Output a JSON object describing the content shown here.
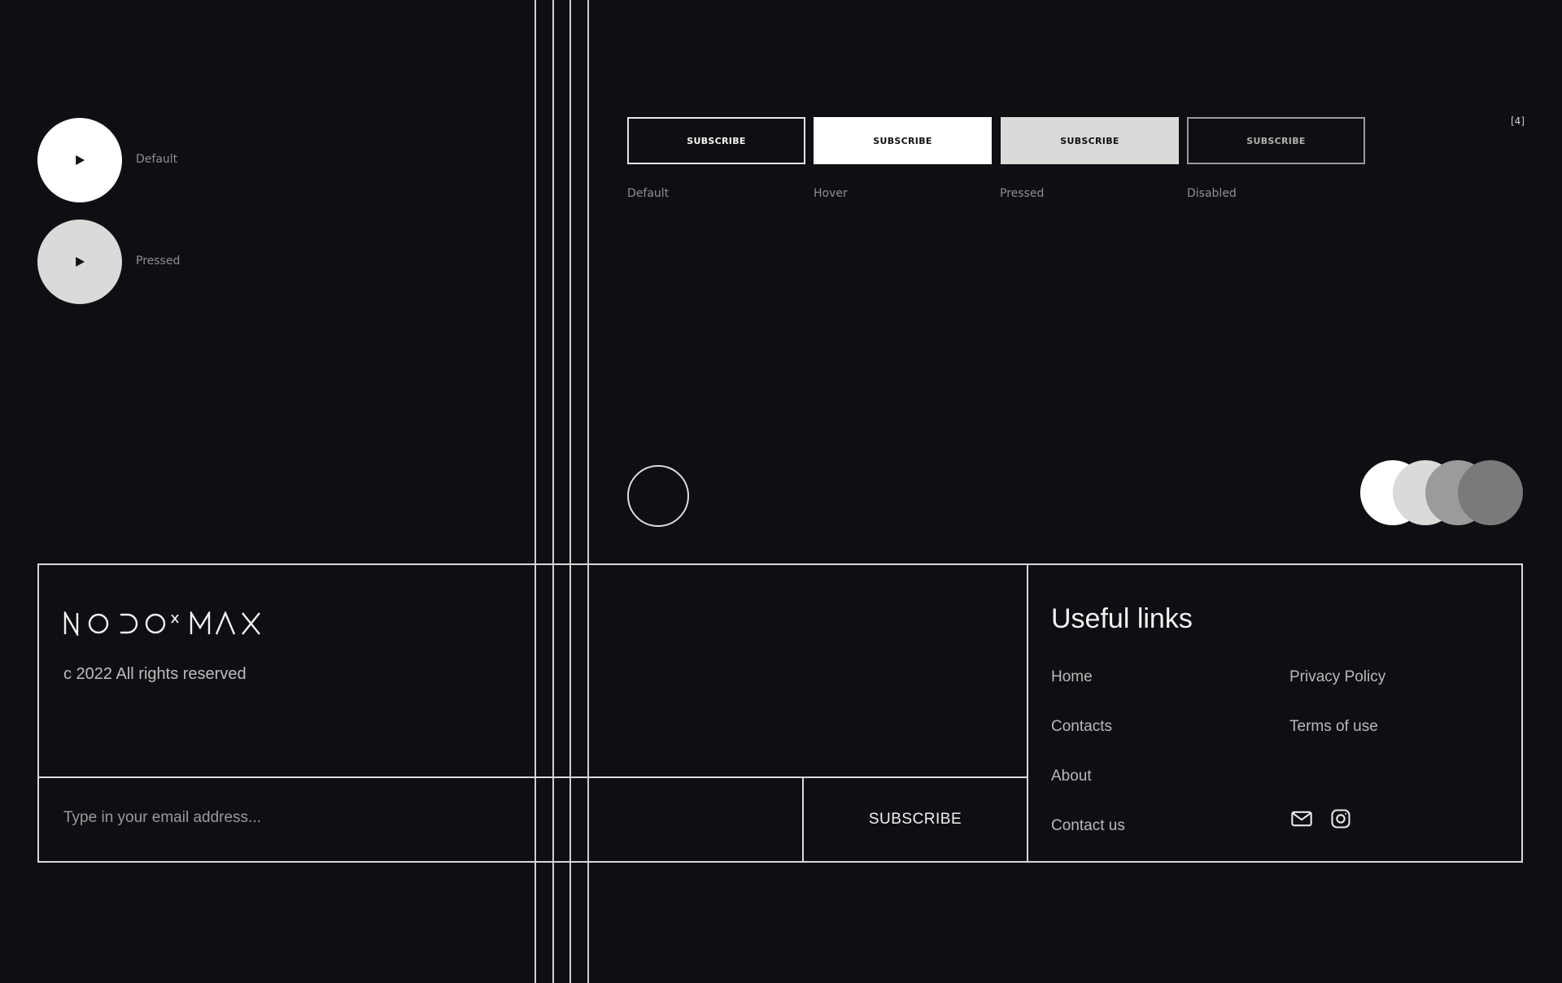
{
  "play_buttons": [
    {
      "label": "Default",
      "color": "#ffffff"
    },
    {
      "label": "Pressed",
      "color": "#dcd9d9"
    }
  ],
  "subscribe_states": {
    "button_text": "SUBSCRIBE",
    "states": [
      "Default",
      "Hover",
      "Pressed",
      "Disabled"
    ],
    "counter": "[4]"
  },
  "color_swatches": [
    "#ffffff",
    "#dcd9d9",
    "#9b9b9b",
    "#7a7a7a"
  ],
  "footer": {
    "logo_text": "NODO x MAX",
    "copyright": "c 2022 All rights reserved",
    "email_placeholder": "Type in your email address...",
    "subscribe_label": "SUBSCRIBE",
    "useful_links_title": "Useful links",
    "links_col1": [
      "Home",
      "Contacts",
      "About",
      "Contact us"
    ],
    "links_col2": [
      "Privacy Policy",
      "Terms of use"
    ],
    "social_icons": [
      "mail-icon",
      "instagram-icon"
    ]
  }
}
